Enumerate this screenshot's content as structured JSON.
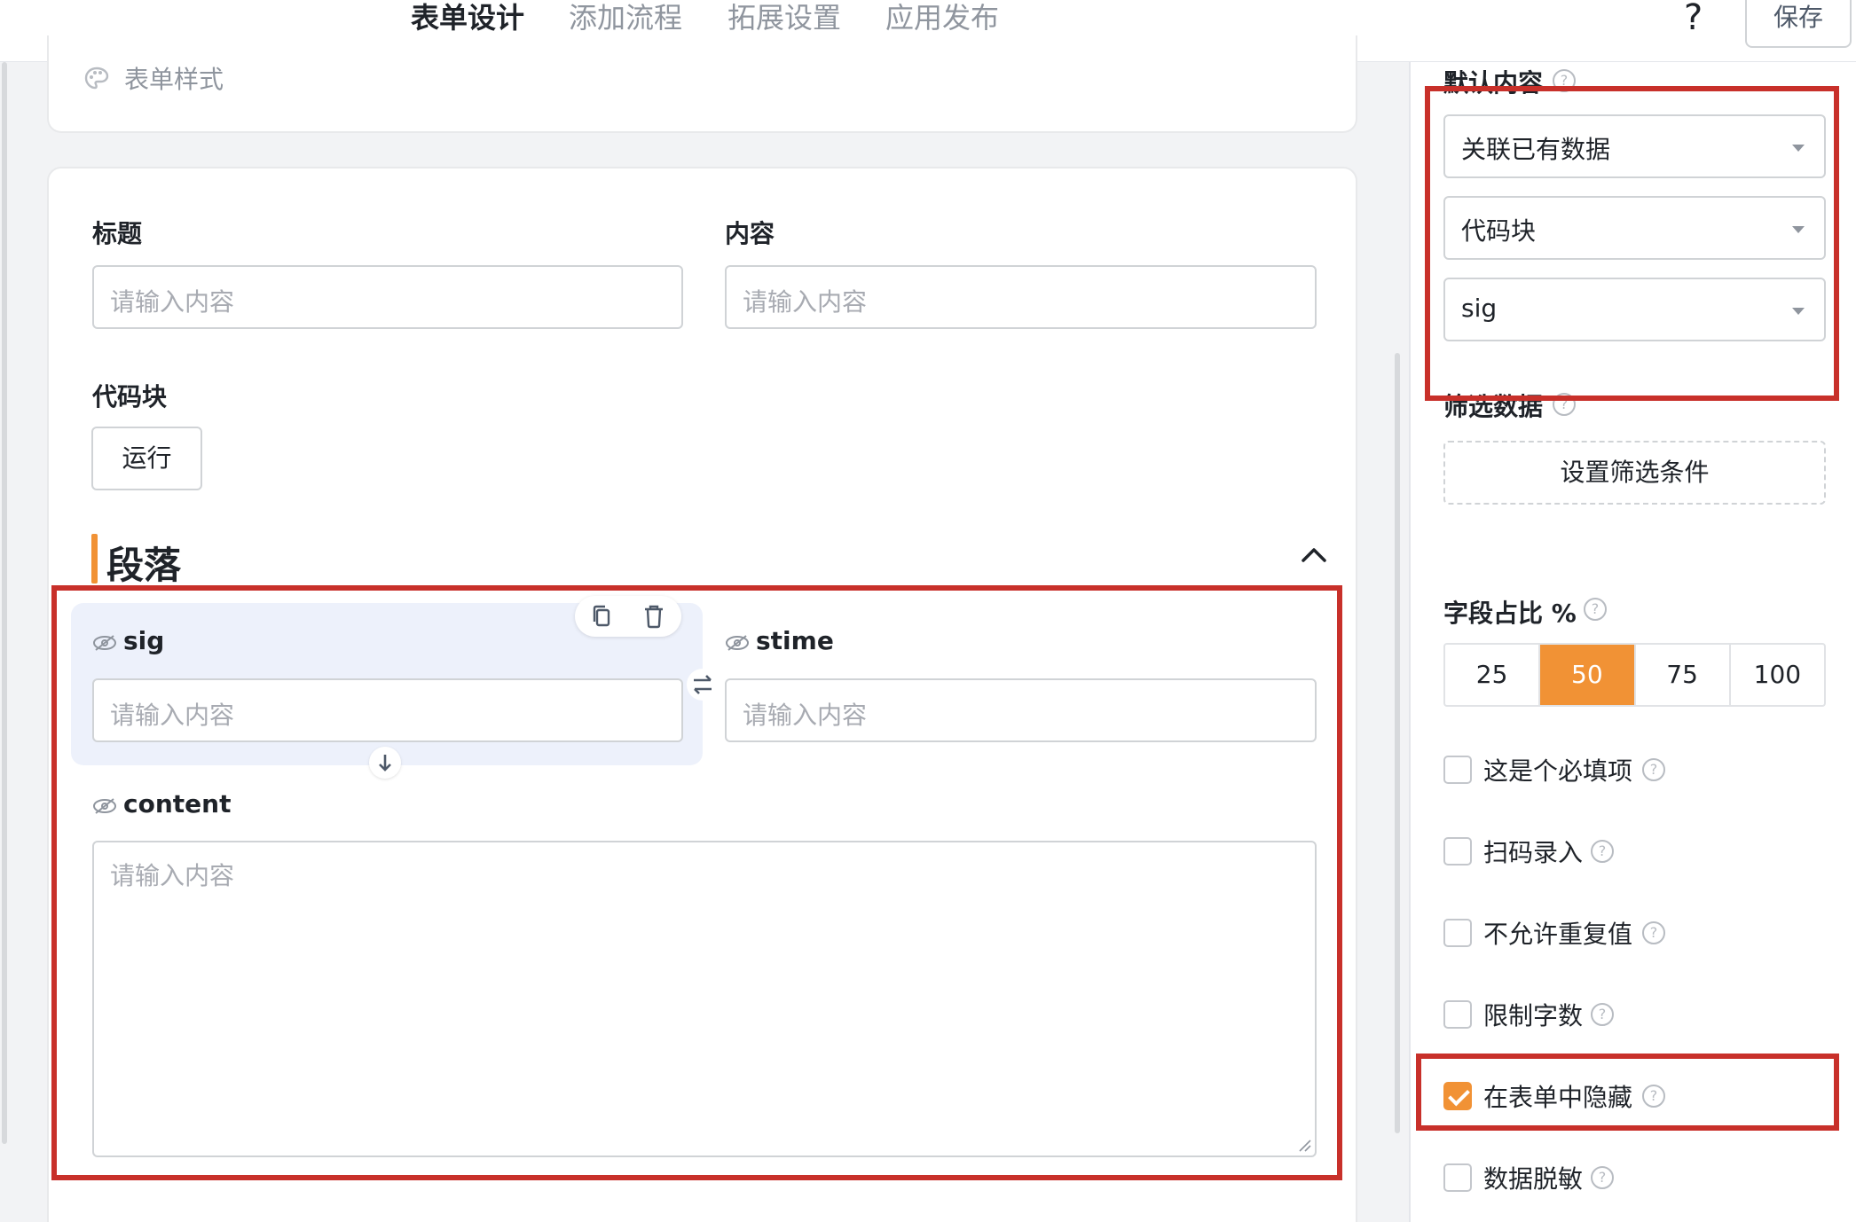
{
  "header": {
    "tabs": [
      {
        "label": "表单设计",
        "active": true
      },
      {
        "label": "添加流程",
        "active": false
      },
      {
        "label": "拓展设置",
        "active": false
      },
      {
        "label": "应用发布",
        "active": false
      }
    ],
    "help_glyph": "?",
    "save_label": "保存"
  },
  "canvas": {
    "form_style_label": "表单样式",
    "fields": {
      "title": {
        "label": "标题",
        "placeholder": "请输入内容"
      },
      "content_top": {
        "label": "内容",
        "placeholder": "请输入内容"
      },
      "code_block": {
        "label": "代码块",
        "button": "运行"
      }
    },
    "section": {
      "title": "段落",
      "fields": {
        "sig": {
          "label": "sig",
          "placeholder": "请输入内容",
          "selected": true
        },
        "stime": {
          "label": "stime",
          "placeholder": "请输入内容"
        },
        "content": {
          "label": "content",
          "placeholder": "请输入内容"
        }
      }
    }
  },
  "props": {
    "default_content_label": "默认内容",
    "default_selects": [
      "关联已有数据",
      "代码块",
      "sig"
    ],
    "filter_label": "筛选数据",
    "filter_button": "设置筛选条件",
    "ratio_label": "字段占比 %",
    "ratio_options": [
      "25",
      "50",
      "75",
      "100"
    ],
    "ratio_selected": "50",
    "checkboxes": [
      {
        "label": "这是个必填项",
        "checked": false
      },
      {
        "label": "扫码录入",
        "checked": false
      },
      {
        "label": "不允许重复值",
        "checked": false
      },
      {
        "label": "限制字数",
        "checked": false
      },
      {
        "label": "在表单中隐藏",
        "checked": true
      },
      {
        "label": "数据脱敏",
        "checked": false
      }
    ]
  },
  "colors": {
    "accent": "#f19235",
    "highlight": "#c8302a",
    "selected_bg": "#edf1fb"
  }
}
